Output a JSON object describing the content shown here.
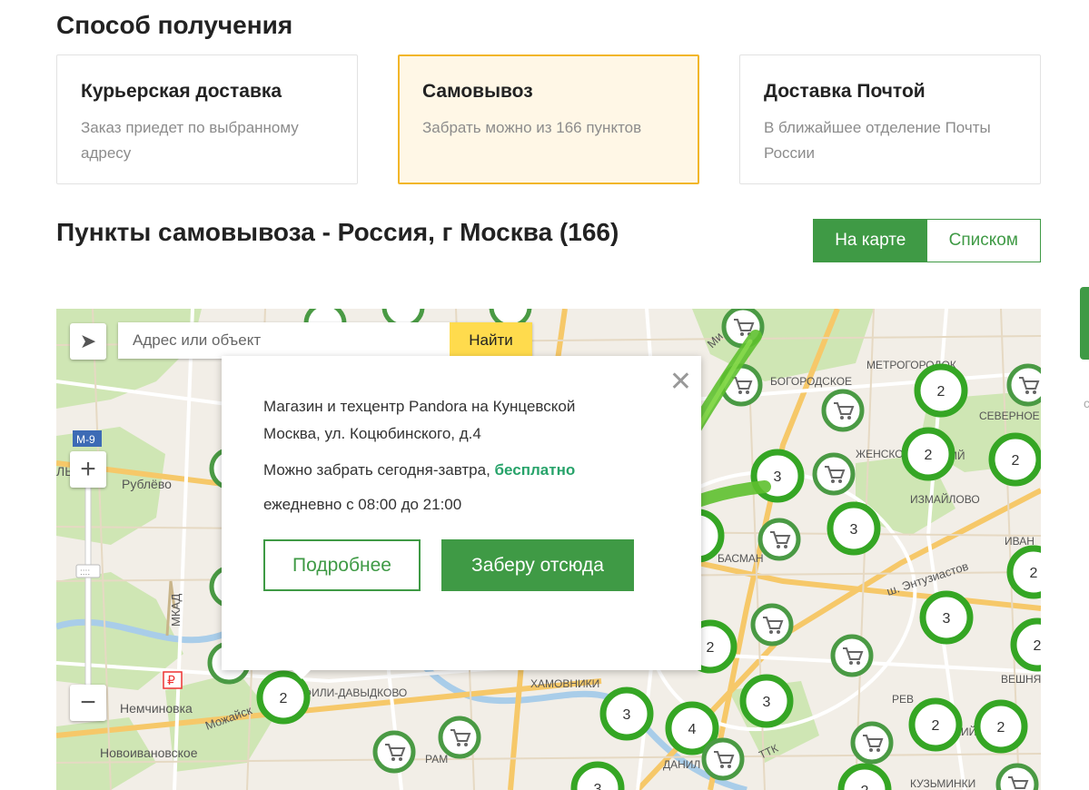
{
  "section_title": "Способ получения",
  "delivery_options": [
    {
      "title": "Курьерская доставка",
      "desc": "Заказ приедет по выбранному адресу",
      "selected": false
    },
    {
      "title": "Самовывоз",
      "desc": "Забрать можно из 166 пунктов",
      "selected": true
    },
    {
      "title": "Доставка Почтой",
      "desc": "В ближайшее отделение Почты России",
      "selected": false
    }
  ],
  "pickup_title": "Пункты самовывоза - Россия, г Москва (166)",
  "view_toggle": {
    "map": "На карте",
    "list": "Списком",
    "active": "map"
  },
  "search": {
    "placeholder": "Адрес или объект",
    "button": "Найти"
  },
  "popup": {
    "name": "Магазин и техцентр Pandora на Кунцевской",
    "address": "Москва, ул. Коцюбинского, д.4",
    "pickup_text": "Можно забрать сегодня-завтра,",
    "price": "бесплатно",
    "hours": "ежедневно с 08:00 до 21:00",
    "details_button": "Подробнее",
    "pick_button": "Заберу отсюда"
  },
  "map_labels": [
    "Рублёво",
    "Немчиновка",
    "Новоивановское",
    "МКАД",
    "М-9",
    "Можайск",
    "ФИЛИ-ДАВЫДКОВО",
    "ХАМОВНИКИ",
    "ДАНИЛ",
    "РАМ",
    "ТТК",
    "БОГОРОДСКОЕ",
    "МЕТРОГОРОДОК",
    "СЕВЕРНОЕ ИЗМАЙЛОВО",
    "ИЗМАЙЛОВО",
    "ЖЕНСКО",
    "ш. Энтузиастов",
    "БАСМАН",
    "ВЕШНЯ",
    "КУЗЬМИНКИ",
    "ИВАН",
    "ЛЬ",
    "Ми",
    "РЕВ",
    "РЯЗАНСКИЙ",
    "ЕВСКИЙ"
  ],
  "clusters": [
    "2",
    "2",
    "2",
    "2",
    "3",
    "3",
    "2",
    "3",
    "3",
    "2",
    "2",
    "2",
    "3",
    "4",
    "3",
    "2",
    "2",
    "2"
  ],
  "colors": {
    "accent": "#3f9a45",
    "selected_border": "#f2b62a",
    "selected_bg": "#fff7e6",
    "find_button": "#ffdb4d",
    "cluster_ring": "#3aa629",
    "free_text": "#27a36a"
  },
  "icons": [
    "locate-arrow-icon",
    "zoom-in-icon",
    "zoom-out-icon",
    "close-icon",
    "cart-icon",
    "checkmark-icon",
    "metro-icon"
  ]
}
